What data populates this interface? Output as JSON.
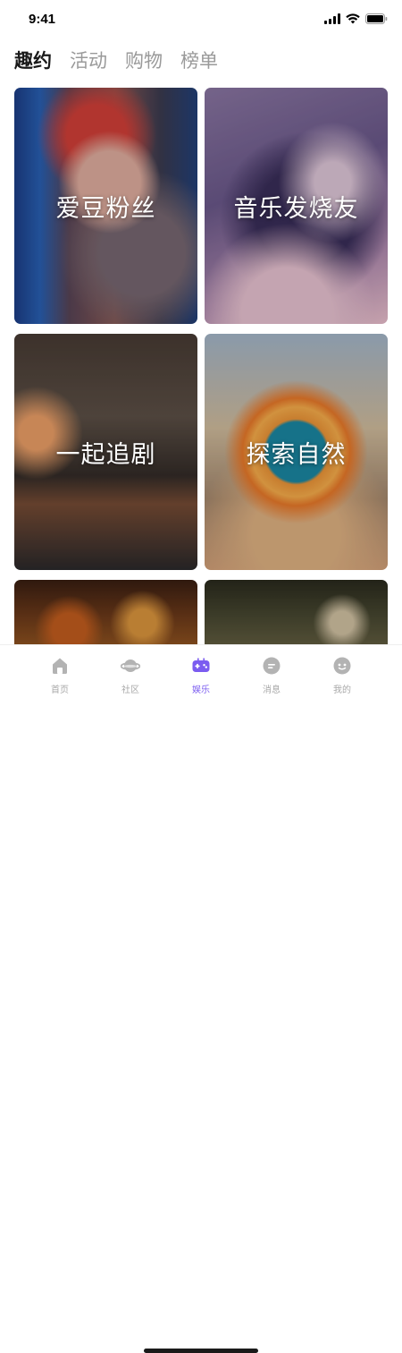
{
  "status_bar": {
    "time": "9:41"
  },
  "tabs": [
    {
      "label": "趣约",
      "active": true
    },
    {
      "label": "活动",
      "active": false
    },
    {
      "label": "购物",
      "active": false
    },
    {
      "label": "榜单",
      "active": false
    }
  ],
  "cards": [
    {
      "label": "爱豆粉丝"
    },
    {
      "label": "音乐发烧友"
    },
    {
      "label": "一起追剧"
    },
    {
      "label": "探索自然"
    }
  ],
  "bottom_nav": [
    {
      "label": "首页",
      "icon": "home-icon",
      "active": false
    },
    {
      "label": "社区",
      "icon": "planet-icon",
      "active": false
    },
    {
      "label": "娱乐",
      "icon": "gamepad-icon",
      "active": true
    },
    {
      "label": "消息",
      "icon": "chat-icon",
      "active": false
    },
    {
      "label": "我的",
      "icon": "profile-face-icon",
      "active": false
    }
  ],
  "colors": {
    "accent": "#7b5cf0",
    "inactive": "#a8a8a8",
    "tab_inactive": "#9a9a9a"
  }
}
